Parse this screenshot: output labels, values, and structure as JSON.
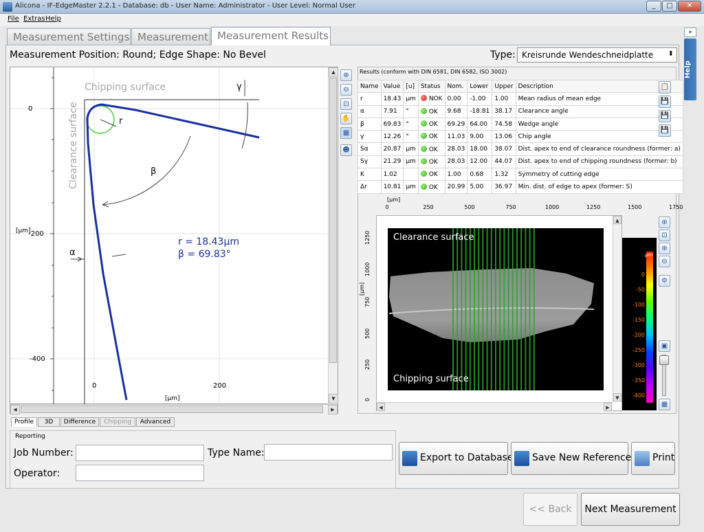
{
  "window": {
    "title": "Alicona - IF-EdgeMaster 2.2.1 - Database: db - User Name: Administrator - User Level: Normal User",
    "controls": [
      "_",
      "□",
      "✕"
    ]
  },
  "menu": [
    "File",
    "Extras",
    "Help"
  ],
  "tabs": [
    "Measurement Settings",
    "Measurement",
    "Measurement Results"
  ],
  "help_label": "Help",
  "position_text": "Measurement Position: Round; Edge Shape: No Bevel",
  "type": {
    "label": "Type:",
    "value": "Kreisrunde Wendeschneidplatte"
  },
  "profile": {
    "chipping_label": "Chipping surface",
    "clearance_label": "Clearance surface",
    "readout_r": "r = 18.43µm",
    "readout_beta": "β = 69.83°",
    "unit_y": "[µm]",
    "unit_x": "[µm]",
    "y_ticks": [
      "0",
      "-200",
      "-400"
    ],
    "x_ticks": [
      "0",
      "200"
    ],
    "sym_r": "r",
    "sym_beta": "β",
    "sym_alpha": "α",
    "sym_gamma": "γ"
  },
  "results_title": "Results (conform with DIN 6581, DIN 6582, ISO 3002)",
  "results_headers": [
    "Name",
    "Value",
    "[u]",
    "Status",
    "Nom.",
    "Lower",
    "Upper",
    "Description"
  ],
  "results_rows": [
    {
      "name": "r",
      "value": "18.43",
      "unit": "µm",
      "status": "NOK",
      "nom": "0.00",
      "lower": "-1.00",
      "upper": "1.00",
      "desc": "Mean radius of mean edge"
    },
    {
      "name": "α",
      "value": "7.91",
      "unit": "°",
      "status": "OK",
      "nom": "9.68",
      "lower": "-18.81",
      "upper": "38.17",
      "desc": "Clearance angle"
    },
    {
      "name": "β",
      "value": "69.83",
      "unit": "°",
      "status": "OK",
      "nom": "69.29",
      "lower": "64.00",
      "upper": "74.58",
      "desc": "Wedge angle"
    },
    {
      "name": "γ",
      "value": "12.26",
      "unit": "°",
      "status": "OK",
      "nom": "11.03",
      "lower": "9.00",
      "upper": "13.06",
      "desc": "Chip angle"
    },
    {
      "name": "Sα",
      "value": "20.87",
      "unit": "µm",
      "status": "OK",
      "nom": "28.03",
      "lower": "18.00",
      "upper": "38.07",
      "desc": "Dist. apex to end of clearance roundness (former: a)"
    },
    {
      "name": "Sγ",
      "value": "21.29",
      "unit": "µm",
      "status": "OK",
      "nom": "28.03",
      "lower": "12.00",
      "upper": "44.07",
      "desc": "Dist. apex to end of chipping roundness (former: b)"
    },
    {
      "name": "K",
      "value": "1.02",
      "unit": "",
      "status": "OK",
      "nom": "1.00",
      "lower": "0.68",
      "upper": "1.32",
      "desc": "Symmetry of cutting edge"
    },
    {
      "name": "Δr",
      "value": "10.81",
      "unit": "µm",
      "status": "OK",
      "nom": "20.99",
      "lower": "5.00",
      "upper": "36.97",
      "desc": "Min. dist. of edge to apex (former: S)"
    }
  ],
  "image3d": {
    "unit": "[µm]",
    "unit_y": "[µm]",
    "x_ticks": [
      "0",
      "250",
      "500",
      "750",
      "1000",
      "1250",
      "1500",
      "1750"
    ],
    "y_ticks": [
      "1250",
      "1000",
      "750",
      "500",
      "250",
      "0"
    ],
    "clearance_label": "Clearance surface",
    "chipping_label": "Chipping surface"
  },
  "colorbar": {
    "unit": "µm",
    "ticks": [
      "0",
      "-50",
      "-100",
      "-150",
      "-200",
      "-250",
      "-300",
      "-350",
      "-400"
    ]
  },
  "bottom_tabs": [
    "Profile",
    "3D",
    "Difference",
    "Chipping",
    "Advanced"
  ],
  "reporting": {
    "title": "Reporting",
    "job_label": "Job Number:",
    "type_label": "Type Name:",
    "operator_label": "Operator:",
    "job_value": "",
    "type_value": "",
    "operator_value": ""
  },
  "buttons": {
    "export": "Export to Database",
    "save_ref": "Save New Reference",
    "print": "Print",
    "back": "<< Back",
    "next": "Next Measurement"
  },
  "colors": {
    "profile_line": "#1a2fa0",
    "ok": "#2ea81a",
    "nok": "#c41a0a",
    "tab_border": "#8fa3bb"
  }
}
